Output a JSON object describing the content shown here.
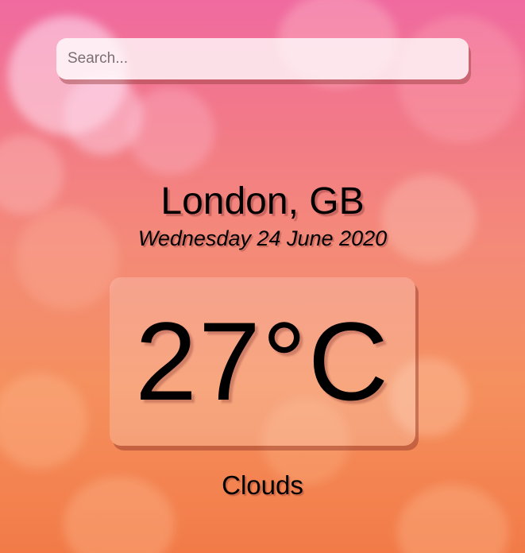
{
  "search": {
    "placeholder": "Search...",
    "value": ""
  },
  "location": {
    "city_country": "London, GB"
  },
  "date": {
    "text": "Wednesday 24 June 2020"
  },
  "current": {
    "temperature": "27°C",
    "condition": "Clouds"
  },
  "colors": {
    "background_top": "#f06aa0",
    "background_bottom": "#f27b48"
  }
}
